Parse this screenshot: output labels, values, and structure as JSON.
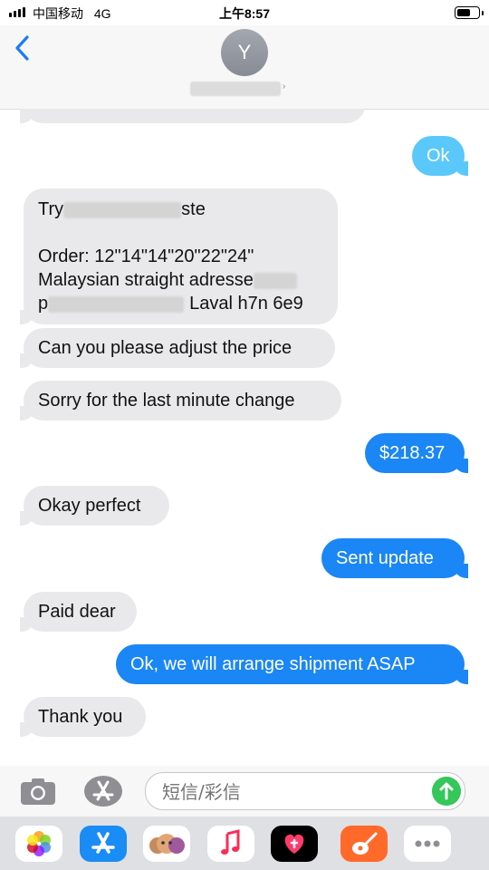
{
  "status_bar": {
    "carrier": "中国移动",
    "network": "4G",
    "time": "上午8:57"
  },
  "header": {
    "avatar_initial": "Y"
  },
  "messages": {
    "ok": "Ok",
    "address_line1_start": "Try",
    "address_line1_end": "ste",
    "order_line": "Order: 12\"14\"14\"20\"22\"24\"",
    "product_line": "Malaysian straight adresse",
    "address_line3_start": "p",
    "address_line3_end": "Laval h7n 6e9",
    "adjust_price": "Can you please adjust the price",
    "sorry": "Sorry for the last minute change",
    "price": "$218.37",
    "okay_perfect": "Okay perfect",
    "sent_update": "Sent update",
    "paid": "Paid dear",
    "arrange": "Ok, we will arrange shipment ASAP",
    "thank_you": "Thank you"
  },
  "input": {
    "placeholder": "短信/彩信"
  },
  "icons": {
    "back": "chevron-left-icon",
    "camera": "camera-icon",
    "app_store": "app-store-icon",
    "send": "send-arrow-icon",
    "drawer": [
      "photos-icon",
      "app-store-icon",
      "memoji-icon",
      "music-icon",
      "digital-touch-icon",
      "garageband-icon",
      "more-icon"
    ]
  },
  "colors": {
    "outgoing": "#1b86f5",
    "incoming": "#e9e9eb",
    "accent": "#1a7cf4",
    "send": "#34c759"
  }
}
